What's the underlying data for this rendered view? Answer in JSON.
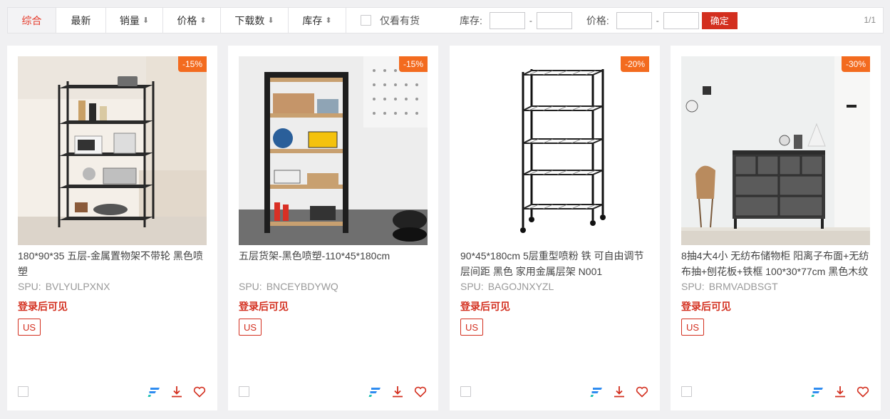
{
  "toolbar": {
    "tabs": [
      {
        "label": "综合",
        "arrow": ""
      },
      {
        "label": "最新",
        "arrow": ""
      },
      {
        "label": "销量",
        "arrow": "⬇"
      },
      {
        "label": "价格",
        "arrow": "⬍"
      },
      {
        "label": "下载数",
        "arrow": "⬇"
      },
      {
        "label": "库存",
        "arrow": "⬍"
      }
    ],
    "only_stock_label": "仅看有货",
    "stock_label": "库存:",
    "price_label": "价格:",
    "range_sep": "-",
    "confirm_label": "确定",
    "pager": "1/1"
  },
  "products": [
    {
      "discount": "-15%",
      "title": "180*90*35 五层-金属置物架不带轮 黑色喷塑",
      "spu_label": "SPU:",
      "spu": "BVLYULPXNX",
      "login_text": "登录后可见",
      "region": "US"
    },
    {
      "discount": "-15%",
      "title": "五层货架-黑色喷塑-110*45*180cm",
      "spu_label": "SPU:",
      "spu": "BNCEYBDYWQ",
      "login_text": "登录后可见",
      "region": "US"
    },
    {
      "discount": "-20%",
      "title": "90*45*180cm 5层重型喷粉 铁 可自由调节层间距 黑色 家用金属层架 N001",
      "spu_label": "SPU:",
      "spu": "BAGOJNXYZL",
      "login_text": "登录后可见",
      "region": "US"
    },
    {
      "discount": "-30%",
      "title": "8抽4大4小 无纺布储物柜 阳离子布面+无纺布抽+刨花板+铁框 100*30*77cm 黑色木纹",
      "spu_label": "SPU:",
      "spu": "BRMVADBSGT",
      "login_text": "登录后可见",
      "region": "US"
    }
  ],
  "colors": {
    "accent": "#d32f1f",
    "badge": "#f36b1f",
    "brand_icon": "#2f8cf0"
  }
}
